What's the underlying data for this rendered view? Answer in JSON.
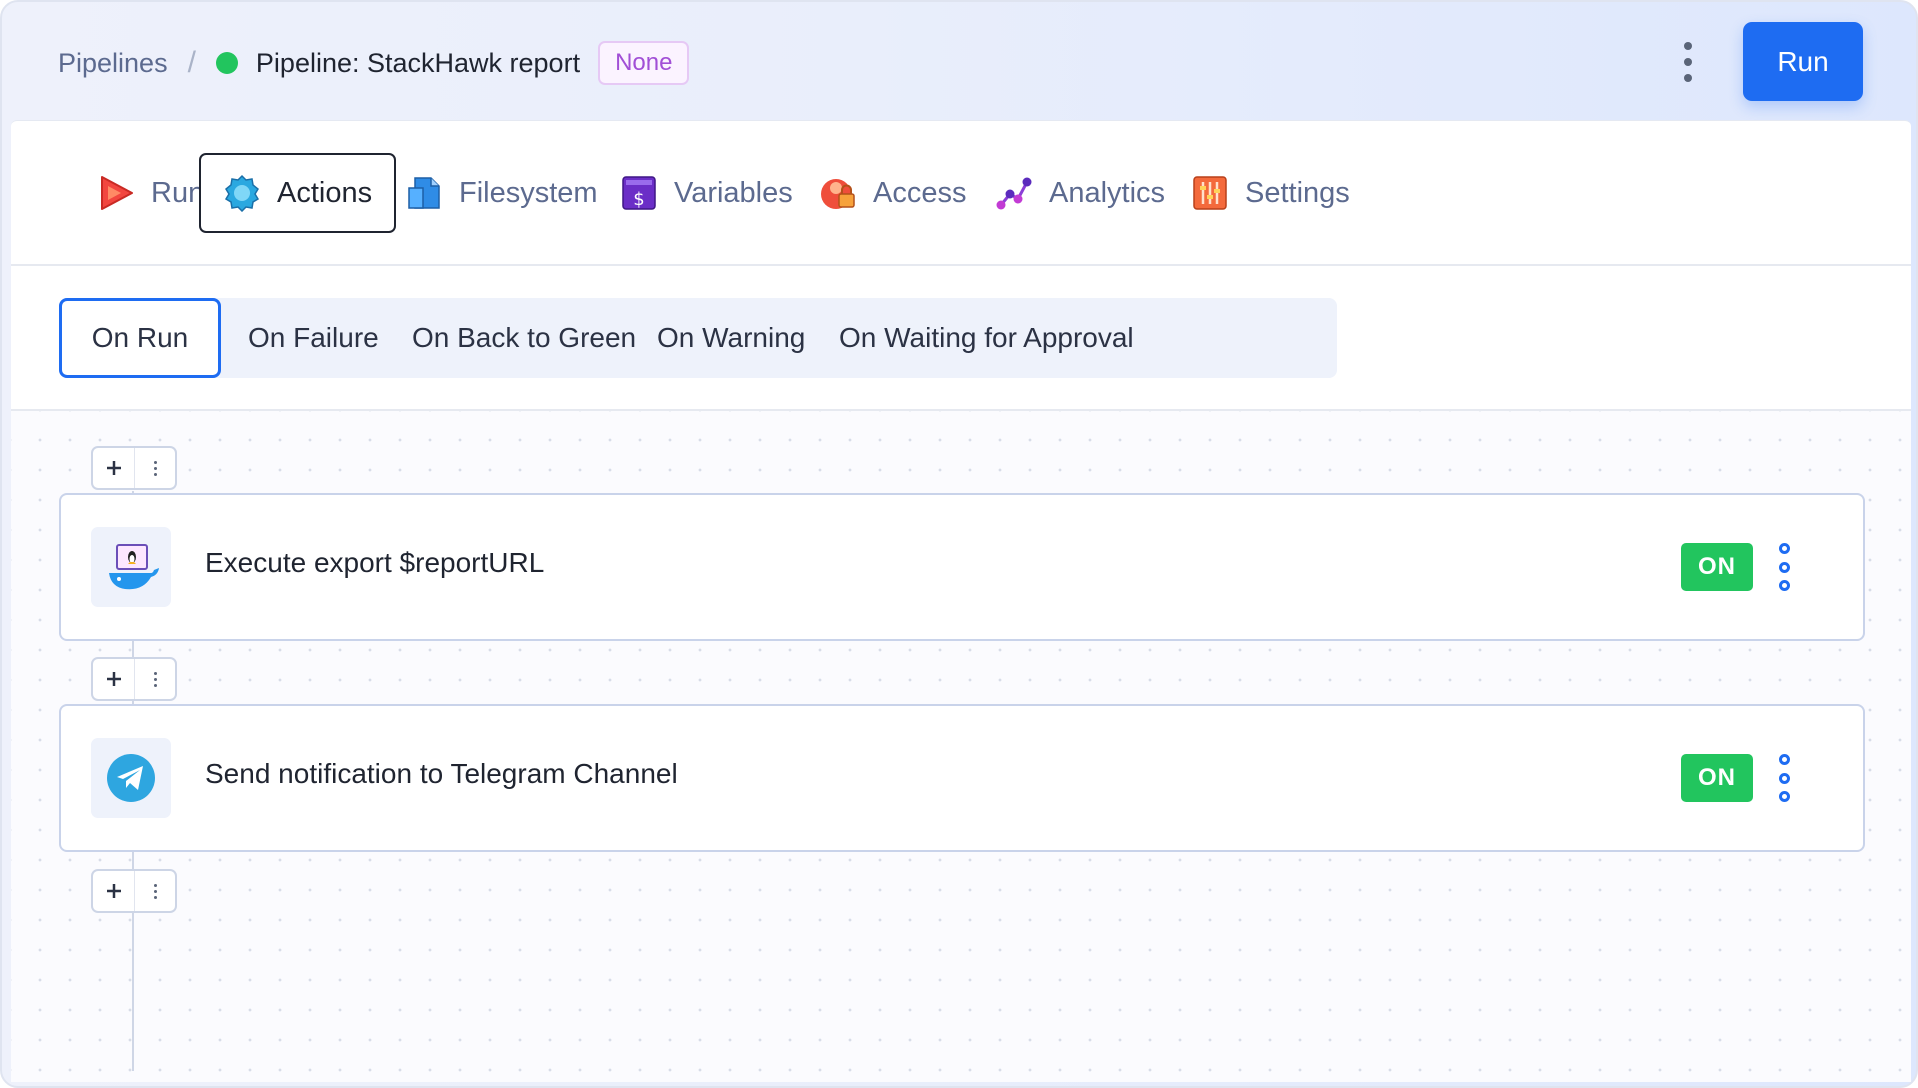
{
  "breadcrumb": {
    "root": "Pipelines",
    "separator": "/",
    "pipeline_title": "Pipeline: StackHawk report",
    "tag": "None",
    "status_color": "#22c55e"
  },
  "header": {
    "run_label": "Run"
  },
  "tabs": [
    {
      "label": "Runs",
      "icon": "play-icon"
    },
    {
      "label": "Actions",
      "icon": "gear-icon",
      "active": true
    },
    {
      "label": "Filesystem",
      "icon": "file-icon"
    },
    {
      "label": "Variables",
      "icon": "dollar-icon"
    },
    {
      "label": "Access",
      "icon": "lock-icon"
    },
    {
      "label": "Analytics",
      "icon": "analytics-icon"
    },
    {
      "label": "Settings",
      "icon": "sliders-icon"
    }
  ],
  "triggers": [
    {
      "label": "On Run",
      "active": true
    },
    {
      "label": "On Failure"
    },
    {
      "label": "On Back to Green"
    },
    {
      "label": "On Warning"
    },
    {
      "label": "On Waiting for Approval"
    }
  ],
  "actions": [
    {
      "title": "Execute export $reportURL",
      "icon": "docker-linux-icon",
      "status": "ON"
    },
    {
      "title": "Send notification to Telegram Channel",
      "icon": "telegram-icon",
      "status": "ON"
    }
  ],
  "colors": {
    "accent": "#1e6cf2",
    "on": "#22c55e",
    "tag": "#a14fd6"
  }
}
